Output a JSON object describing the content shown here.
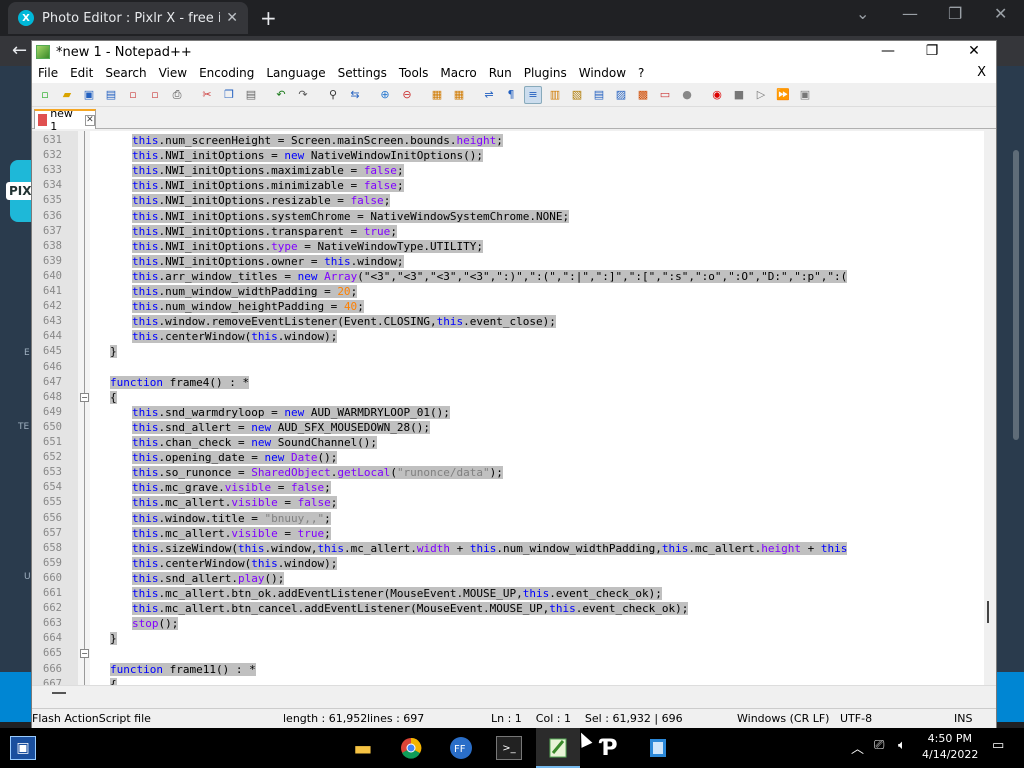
{
  "browser": {
    "tab_title": "Photo Editor : Pixlr X - free image",
    "favicon_letter": "X",
    "pixlr_badge": "PIX",
    "side_texts": [
      "E",
      "TE",
      "U"
    ]
  },
  "window": {
    "title": "*new 1 - Notepad++",
    "min": "—",
    "max": "❐",
    "close": "✕"
  },
  "menu": [
    "File",
    "Edit",
    "Search",
    "View",
    "Encoding",
    "Language",
    "Settings",
    "Tools",
    "Macro",
    "Run",
    "Plugins",
    "Window",
    "?"
  ],
  "menu_close": "X",
  "file_tab": {
    "label": "new 1",
    "close": "✕"
  },
  "code_lines": [
    {
      "n": "631",
      "t": [
        [
          "this",
          "kw"
        ],
        [
          ".num_screenHeight = Screen.mainScreen.bounds.",
          ""
        ],
        [
          "height",
          "prop"
        ],
        [
          ";",
          ""
        ]
      ]
    },
    {
      "n": "632",
      "t": [
        [
          "this",
          "kw"
        ],
        [
          ".NWI_initOptions = ",
          ""
        ],
        [
          "new",
          "kw"
        ],
        [
          " NativeWindowInitOptions();",
          ""
        ]
      ]
    },
    {
      "n": "633",
      "t": [
        [
          "this",
          "kw"
        ],
        [
          ".NWI_initOptions.maximizable = ",
          ""
        ],
        [
          "false",
          "prop"
        ],
        [
          ";",
          ""
        ]
      ]
    },
    {
      "n": "634",
      "t": [
        [
          "this",
          "kw"
        ],
        [
          ".NWI_initOptions.minimizable = ",
          ""
        ],
        [
          "false",
          "prop"
        ],
        [
          ";",
          ""
        ]
      ]
    },
    {
      "n": "635",
      "t": [
        [
          "this",
          "kw"
        ],
        [
          ".NWI_initOptions.resizable = ",
          ""
        ],
        [
          "false",
          "prop"
        ],
        [
          ";",
          ""
        ]
      ]
    },
    {
      "n": "636",
      "t": [
        [
          "this",
          "kw"
        ],
        [
          ".NWI_initOptions.systemChrome = NativeWindowSystemChrome.NONE;",
          ""
        ]
      ]
    },
    {
      "n": "637",
      "t": [
        [
          "this",
          "kw"
        ],
        [
          ".NWI_initOptions.transparent = ",
          ""
        ],
        [
          "true",
          "prop"
        ],
        [
          ";",
          ""
        ]
      ]
    },
    {
      "n": "638",
      "t": [
        [
          "this",
          "kw"
        ],
        [
          ".NWI_initOptions.",
          ""
        ],
        [
          "type",
          "prop"
        ],
        [
          " = NativeWindowType.UTILITY;",
          ""
        ]
      ]
    },
    {
      "n": "639",
      "t": [
        [
          "this",
          "kw"
        ],
        [
          ".NWI_initOptions.owner = ",
          ""
        ],
        [
          "this",
          "kw"
        ],
        [
          ".window;",
          ""
        ]
      ]
    },
    {
      "n": "640",
      "t": [
        [
          "this",
          "kw"
        ],
        [
          ".arr_window_titles = ",
          ""
        ],
        [
          "new",
          "kw"
        ],
        [
          " ",
          ""
        ],
        [
          "Array",
          "prop"
        ],
        [
          "(",
          ""
        ],
        [
          "\"<3\",\"<3\",\"<3\",\"<3\",\":)\",\":(\",\":|\",\":]\",\":[\",\":s\",\":o\",\":O\",\"D:\",\":p\",\":(",
          ""
        ],
        [
          "",
          "str"
        ]
      ]
    },
    {
      "n": "641",
      "t": [
        [
          "this",
          "kw"
        ],
        [
          ".num_window_widthPadding = ",
          ""
        ],
        [
          "20",
          "num"
        ],
        [
          ";",
          ""
        ]
      ]
    },
    {
      "n": "642",
      "t": [
        [
          "this",
          "kw"
        ],
        [
          ".num_window_heightPadding = ",
          ""
        ],
        [
          "40",
          "num"
        ],
        [
          ";",
          ""
        ]
      ]
    },
    {
      "n": "643",
      "t": [
        [
          "this",
          "kw"
        ],
        [
          ".window.removeEventListener(Event.CLOSING,",
          ""
        ],
        [
          "this",
          "kw"
        ],
        [
          ".event_close);",
          ""
        ]
      ]
    },
    {
      "n": "644",
      "t": [
        [
          "this",
          "kw"
        ],
        [
          ".centerWindow(",
          ""
        ],
        [
          "this",
          "kw"
        ],
        [
          ".window);",
          ""
        ]
      ]
    },
    {
      "n": "645",
      "t": [
        [
          "}",
          ""
        ]
      ],
      "indent": 1
    },
    {
      "n": "646",
      "t": [],
      "indent": 1
    },
    {
      "n": "647",
      "t": [
        [
          "function",
          "kw"
        ],
        [
          " frame4() : *",
          ""
        ]
      ],
      "indent": 1
    },
    {
      "n": "648",
      "t": [
        [
          "{",
          ""
        ]
      ],
      "indent": 1
    },
    {
      "n": "649",
      "t": [
        [
          "this",
          "kw"
        ],
        [
          ".snd_warmdryloop = ",
          ""
        ],
        [
          "new",
          "kw"
        ],
        [
          " AUD_WARMDRYLOOP_01();",
          ""
        ]
      ]
    },
    {
      "n": "650",
      "t": [
        [
          "this",
          "kw"
        ],
        [
          ".snd_allert = ",
          ""
        ],
        [
          "new",
          "kw"
        ],
        [
          " AUD_SFX_MOUSEDOWN_28();",
          ""
        ]
      ]
    },
    {
      "n": "651",
      "t": [
        [
          "this",
          "kw"
        ],
        [
          ".chan_check = ",
          ""
        ],
        [
          "new",
          "kw"
        ],
        [
          " SoundChannel();",
          ""
        ]
      ]
    },
    {
      "n": "652",
      "t": [
        [
          "this",
          "kw"
        ],
        [
          ".opening_date = ",
          ""
        ],
        [
          "new",
          "kw"
        ],
        [
          " ",
          ""
        ],
        [
          "Date",
          "prop"
        ],
        [
          "();",
          ""
        ]
      ]
    },
    {
      "n": "653",
      "t": [
        [
          "this",
          "kw"
        ],
        [
          ".so_runonce = ",
          ""
        ],
        [
          "SharedObject",
          "prop"
        ],
        [
          ".",
          ""
        ],
        [
          "getLocal",
          "prop"
        ],
        [
          "(",
          ""
        ],
        [
          "\"runonce/data\"",
          "str"
        ],
        [
          ");",
          ""
        ]
      ]
    },
    {
      "n": "654",
      "t": [
        [
          "this",
          "kw"
        ],
        [
          ".mc_grave.",
          ""
        ],
        [
          "visible",
          "prop"
        ],
        [
          " = ",
          ""
        ],
        [
          "false",
          "prop"
        ],
        [
          ";",
          ""
        ]
      ]
    },
    {
      "n": "655",
      "t": [
        [
          "this",
          "kw"
        ],
        [
          ".mc_allert.",
          ""
        ],
        [
          "visible",
          "prop"
        ],
        [
          " = ",
          ""
        ],
        [
          "false",
          "prop"
        ],
        [
          ";",
          ""
        ]
      ]
    },
    {
      "n": "656",
      "t": [
        [
          "this",
          "kw"
        ],
        [
          ".window.title = ",
          ""
        ],
        [
          "\"bnuuy,,\"",
          "str"
        ],
        [
          ";",
          ""
        ]
      ]
    },
    {
      "n": "657",
      "t": [
        [
          "this",
          "kw"
        ],
        [
          ".mc_allert.",
          ""
        ],
        [
          "visible",
          "prop"
        ],
        [
          " = ",
          ""
        ],
        [
          "true",
          "prop"
        ],
        [
          ";",
          ""
        ]
      ]
    },
    {
      "n": "658",
      "t": [
        [
          "this",
          "kw"
        ],
        [
          ".sizeWindow(",
          ""
        ],
        [
          "this",
          "kw"
        ],
        [
          ".window,",
          ""
        ],
        [
          "this",
          "kw"
        ],
        [
          ".mc_allert.",
          ""
        ],
        [
          "width",
          "prop"
        ],
        [
          " + ",
          ""
        ],
        [
          "this",
          "kw"
        ],
        [
          ".num_window_widthPadding,",
          ""
        ],
        [
          "this",
          "kw"
        ],
        [
          ".mc_allert.",
          ""
        ],
        [
          "height",
          "prop"
        ],
        [
          " + ",
          ""
        ],
        [
          "this",
          "kw"
        ]
      ]
    },
    {
      "n": "659",
      "t": [
        [
          "this",
          "kw"
        ],
        [
          ".centerWindow(",
          ""
        ],
        [
          "this",
          "kw"
        ],
        [
          ".window);",
          ""
        ]
      ]
    },
    {
      "n": "660",
      "t": [
        [
          "this",
          "kw"
        ],
        [
          ".snd_allert.",
          ""
        ],
        [
          "play",
          "prop"
        ],
        [
          "();",
          ""
        ]
      ]
    },
    {
      "n": "661",
      "t": [
        [
          "this",
          "kw"
        ],
        [
          ".mc_allert.btn_ok.addEventListener(MouseEvent.MOUSE_UP,",
          ""
        ],
        [
          "this",
          "kw"
        ],
        [
          ".event_check_ok);",
          ""
        ]
      ]
    },
    {
      "n": "662",
      "t": [
        [
          "this",
          "kw"
        ],
        [
          ".mc_allert.btn_cancel.addEventListener(MouseEvent.MOUSE_UP,",
          ""
        ],
        [
          "this",
          "kw"
        ],
        [
          ".event_check_ok);",
          ""
        ]
      ]
    },
    {
      "n": "663",
      "t": [
        [
          "stop",
          "prop"
        ],
        [
          "();",
          ""
        ]
      ]
    },
    {
      "n": "664",
      "t": [
        [
          "}",
          ""
        ]
      ],
      "indent": 1
    },
    {
      "n": "665",
      "t": [],
      "indent": 1
    },
    {
      "n": "666",
      "t": [
        [
          "function",
          "kw"
        ],
        [
          " frame11() : *",
          ""
        ]
      ],
      "indent": 1
    },
    {
      "n": "667",
      "t": [
        [
          "{",
          ""
        ]
      ],
      "indent": 1
    }
  ],
  "status": {
    "type": "Flash ActionScript file",
    "length": "length : 61,952",
    "lines": "lines : 697",
    "pos": "Ln : 1    Col : 1    Sel : 61,932 | 696",
    "eol": "Windows (CR LF)",
    "enc": "UTF-8",
    "mode": "INS"
  },
  "taskbar": {
    "time": "4:50 PM",
    "date": "4/14/2022"
  }
}
